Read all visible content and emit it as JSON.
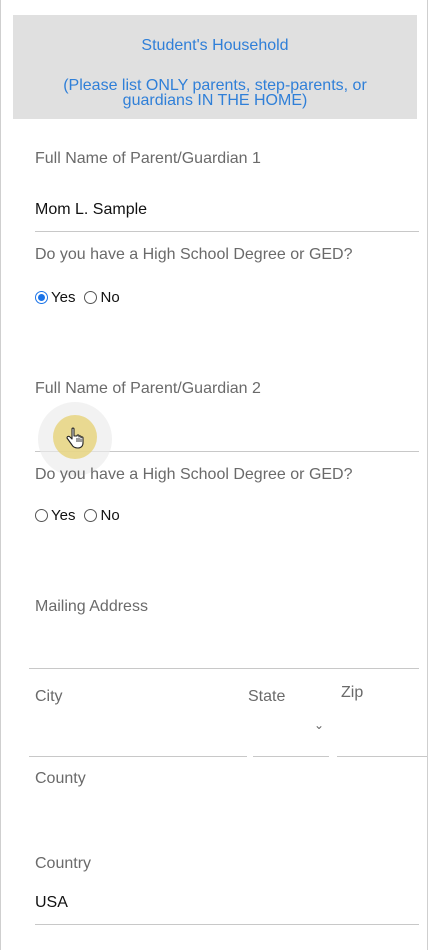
{
  "header": {
    "title": "Student's Household",
    "subtitle_line1": "(Please list ONLY parents, step-parents, or",
    "subtitle_line2": "guardians IN THE HOME)"
  },
  "parent1": {
    "label": "Full Name of Parent/Guardian 1",
    "value": "Mom L. Sample",
    "question": "Do you have a High School Degree or GED?",
    "yes_label": "Yes",
    "no_label": "No",
    "selected": "Yes"
  },
  "parent2": {
    "label": "Full Name of Parent/Guardian 2",
    "value": "",
    "question": "Do you have a High School Degree or GED?",
    "yes_label": "Yes",
    "no_label": "No",
    "selected": ""
  },
  "address": {
    "mailing_label": "Mailing Address",
    "mailing_value": "",
    "city_label": "City",
    "state_label": "State",
    "zip_label": "Zip",
    "county_label": "County",
    "country_label": "Country",
    "country_value": "USA"
  },
  "colors": {
    "accent": "#2f7fd8",
    "radio_checked": "#1a73e8",
    "cursor_highlight": "#e6d278"
  },
  "icons": {
    "cursor": "hand-pointer-icon",
    "state_dropdown": "chevron-down-icon"
  }
}
